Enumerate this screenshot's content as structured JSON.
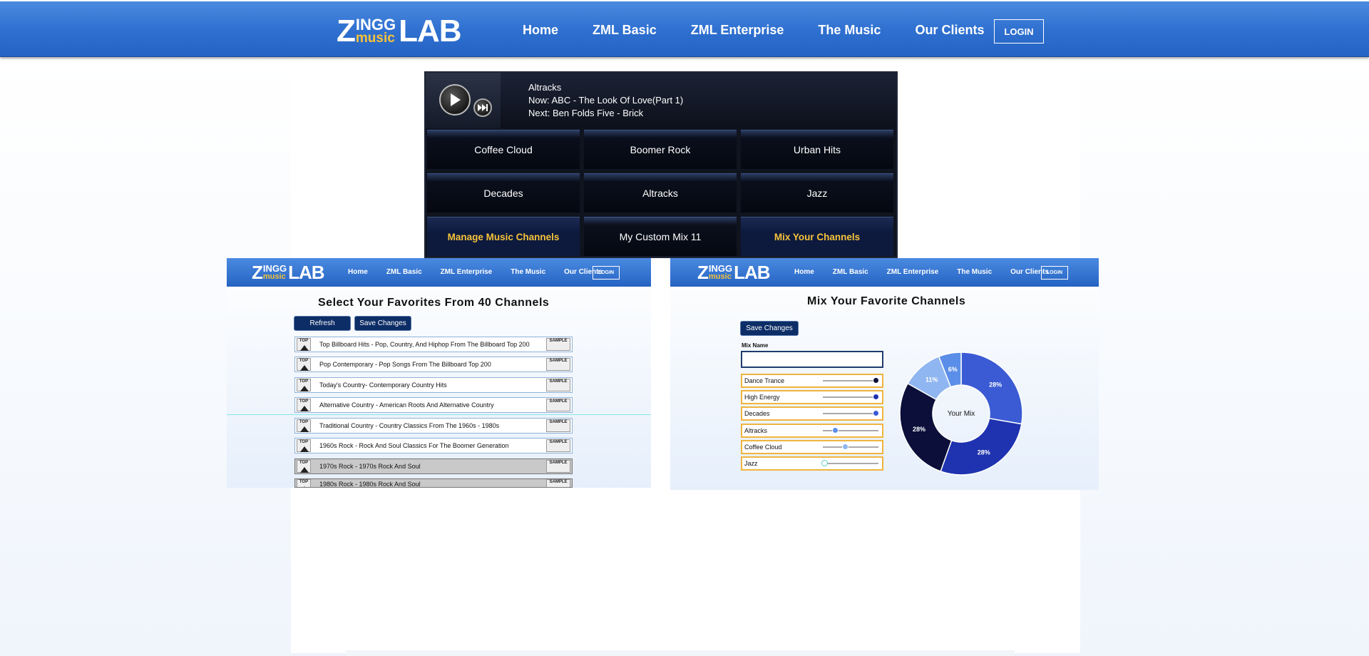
{
  "header": {
    "logo": {
      "z": "Z",
      "ingg": "INGG",
      "music": "music",
      "lab": "LAB"
    },
    "nav": [
      "Home",
      "ZML Basic",
      "ZML Enterprise",
      "The Music",
      "Our Clients"
    ],
    "login": "LOGIN"
  },
  "player": {
    "channel": "Altracks",
    "now": "Now: ABC - The Look Of Love(Part 1)",
    "next": "Next: Ben Folds Five - Brick",
    "channels": [
      {
        "label": "Coffee Cloud",
        "highlight": false
      },
      {
        "label": "Boomer Rock",
        "highlight": false
      },
      {
        "label": "Urban Hits",
        "highlight": false
      },
      {
        "label": "Decades",
        "highlight": false
      },
      {
        "label": "Altracks",
        "highlight": false
      },
      {
        "label": "Jazz",
        "highlight": false
      },
      {
        "label": "Manage Music Channels",
        "highlight": true
      },
      {
        "label": "My Custom Mix 11",
        "highlight": false
      },
      {
        "label": "Mix Your Channels",
        "highlight": true
      }
    ]
  },
  "favorites_page": {
    "title": "Select Your Favorites From 40 Channels",
    "refresh": "Refresh",
    "save": "Save Changes",
    "top_badge": "TOP",
    "sample_badge": "SAMPLE",
    "rows": [
      {
        "text": "Top Billboard Hits   - Pop, Country, And Hiphop From The Billboard Top 200",
        "selected": false
      },
      {
        "text": "Pop Contemporary - Pop Songs From The Billboard Top 200",
        "selected": false
      },
      {
        "text": "Today's Country- Contemporary Country Hits",
        "selected": false
      },
      {
        "text": "Alternative Country - American Roots And Alternative Country",
        "selected": false
      },
      {
        "text": "Traditional Country - Country Classics From The 1960s - 1980s",
        "selected": false
      },
      {
        "text": "1960s Rock - Rock And Soul Classics For The Boomer Generation",
        "selected": false
      },
      {
        "text": "1970s Rock - 1970s Rock And Soul",
        "selected": true
      },
      {
        "text": "1980s Rock - 1980s Rock And Soul",
        "selected": true
      }
    ]
  },
  "mix_page": {
    "title": "Mix Your Favorite Channels",
    "save": "Save Changes",
    "mix_name_label": "Mix Name",
    "mix_name_value": "",
    "sliders": [
      {
        "label": "Dance Trance",
        "level": 0.95,
        "color": "#0b0f3a"
      },
      {
        "label": "High Energy",
        "level": 0.95,
        "color": "#1f33b0"
      },
      {
        "label": "Decades",
        "level": 0.95,
        "color": "#3a5bd4"
      },
      {
        "label": "Altracks",
        "level": 0.22,
        "color": "#5b8ee8"
      },
      {
        "label": "Coffee Cloud",
        "level": 0.4,
        "color": "#8fb6f0"
      },
      {
        "label": "Jazz",
        "level": 0.03,
        "color": "#cfe6ff"
      }
    ],
    "donut_center": "Your Mix",
    "donut": [
      {
        "label": "28%",
        "value": 28,
        "color": "#3a5bd4"
      },
      {
        "label": "28%",
        "value": 28,
        "color": "#1f33b0"
      },
      {
        "label": "28%",
        "value": 28,
        "color": "#0b0f3a"
      },
      {
        "label": "11%",
        "value": 11,
        "color": "#8fb6f0"
      },
      {
        "label": "6%",
        "value": 6,
        "color": "#5b8ee8"
      }
    ]
  }
}
